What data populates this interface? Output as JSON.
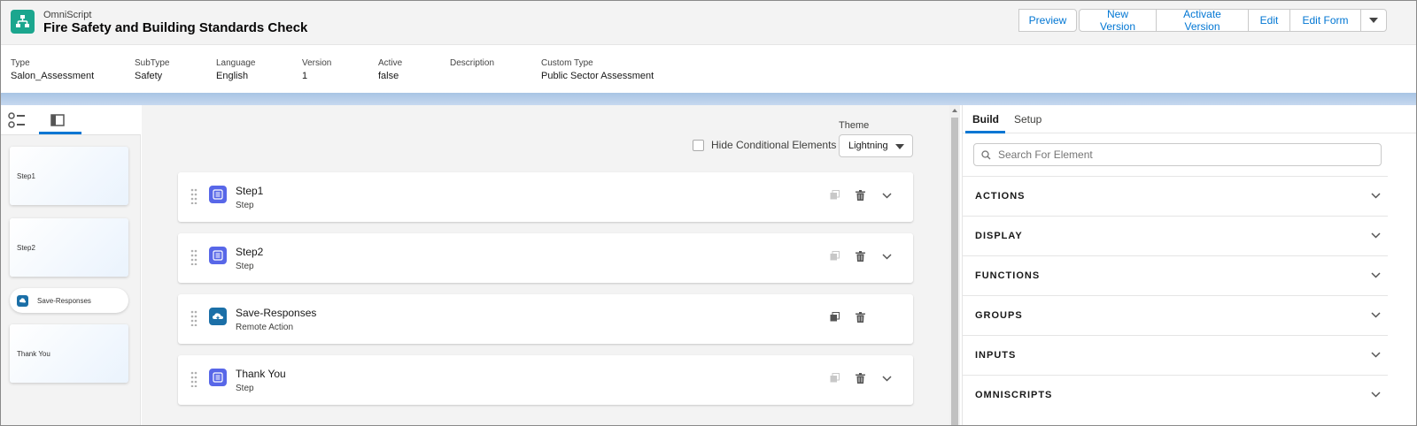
{
  "header": {
    "app_label": "OmniScript",
    "title": "Fire Safety and Building Standards Check",
    "buttons": {
      "preview": "Preview",
      "new_version": "New Version",
      "activate_version": "Activate Version",
      "edit": "Edit",
      "edit_form": "Edit Form"
    }
  },
  "details": [
    {
      "label": "Type",
      "value": "Salon_Assessment"
    },
    {
      "label": "SubType",
      "value": "Safety"
    },
    {
      "label": "Language",
      "value": "English"
    },
    {
      "label": "Version",
      "value": "1"
    },
    {
      "label": "Active",
      "value": "false"
    },
    {
      "label": "Description",
      "value": ""
    },
    {
      "label": "Custom Type",
      "value": "Public Sector Assessment"
    }
  ],
  "sidebar": {
    "items": [
      {
        "label": "Step1"
      },
      {
        "label": "Step2"
      },
      {
        "label": "Save-Responses"
      },
      {
        "label": "Thank You"
      }
    ]
  },
  "canvas": {
    "theme_label": "Theme",
    "theme_value": "Lightning",
    "hide_conditional_label": "Hide Conditional Elements",
    "elements": [
      {
        "name": "Step1",
        "type": "Step"
      },
      {
        "name": "Step2",
        "type": "Step"
      },
      {
        "name": "Save-Responses",
        "type": "Remote Action"
      },
      {
        "name": "Thank You",
        "type": "Step"
      }
    ]
  },
  "right_panel": {
    "tabs": [
      "Build",
      "Setup"
    ],
    "search_placeholder": "Search For Element",
    "sections": [
      "ACTIONS",
      "DISPLAY",
      "FUNCTIONS",
      "GROUPS",
      "INPUTS",
      "OMNISCRIPTS"
    ]
  },
  "colors": {
    "accent": "#0176d3",
    "app_icon": "#1ba68e",
    "step_icon": "#5867e8",
    "remote_action_icon": "#1b6fa7"
  }
}
